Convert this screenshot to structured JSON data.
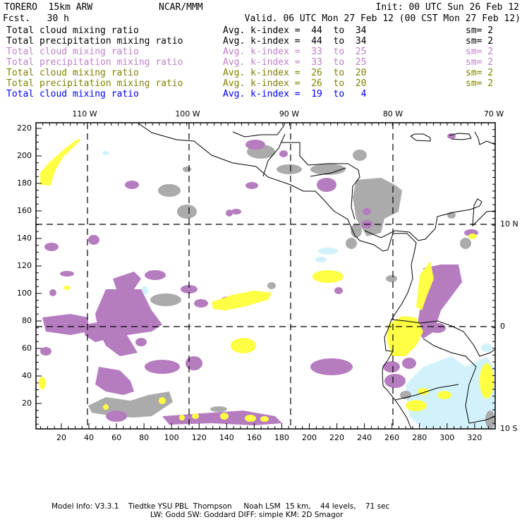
{
  "header": {
    "model": "TORERO  15km ARW",
    "center": "NCAR/MMM",
    "init": "Init: 00 UTC Sun 26 Feb 12",
    "fcst": "Fcst.   30 h",
    "valid": "Valid. 06 UTC Mon 27 Feb 12 (00 CST Mon 27 Feb 12)"
  },
  "legend": [
    {
      "field": "Total cloud mixing ratio",
      "index": "Avg. k-index =  44  to  34",
      "sm": "sm= 2",
      "color": "#000000"
    },
    {
      "field": "Total precipitation mixing ratio",
      "index": "Avg. k-index =  44  to  34",
      "sm": "sm= 2",
      "color": "#000000"
    },
    {
      "field": "Total cloud mixing ratio",
      "index": "Avg. k-index =  33  to  25",
      "sm": "sm= 2",
      "color": "#c080c8"
    },
    {
      "field": "Total precipitation mixing ratio",
      "index": "Avg. k-index =  33  to  25",
      "sm": "sm= 2",
      "color": "#c080c8"
    },
    {
      "field": "Total cloud mixing ratio",
      "index": "Avg. k-index =  26  to  20",
      "sm": "sm= 2",
      "color": "#808000"
    },
    {
      "field": "Total precipitation mixing ratio",
      "index": "Avg. k-index =  26  to  20",
      "sm": "sm= 2",
      "color": "#808000"
    },
    {
      "field": "Total cloud mixing ratio",
      "index": "Avg. k-index =  19  to   4",
      "sm": "",
      "color": "#0000ff"
    }
  ],
  "map": {
    "x_ticks": [
      "20",
      "40",
      "60",
      "80",
      "100",
      "120",
      "140",
      "160",
      "180",
      "200",
      "220",
      "240",
      "260",
      "280",
      "300",
      "320"
    ],
    "y_ticks": [
      "20",
      "40",
      "60",
      "80",
      "100",
      "120",
      "140",
      "160",
      "180",
      "200",
      "220"
    ],
    "lon_labels": [
      "110 W",
      "100 W",
      "90 W",
      "80 W",
      "70 W"
    ],
    "lat_labels": [
      "10 N",
      "0",
      "10 S"
    ],
    "colors": {
      "grey": "#ababab",
      "purple": "#b57cc0",
      "yellow": "#ffff44",
      "lightblue": "#d2f2fb"
    }
  },
  "footer": {
    "line1": "Model Info: V3.3.1    Tiedtke YSU PBL  Thompson     Noah LSM  15 km,    44 levels,    71 sec",
    "line2": "LW: Godd SW: Goddard DIFF: simple KM: 2D Smagor"
  }
}
